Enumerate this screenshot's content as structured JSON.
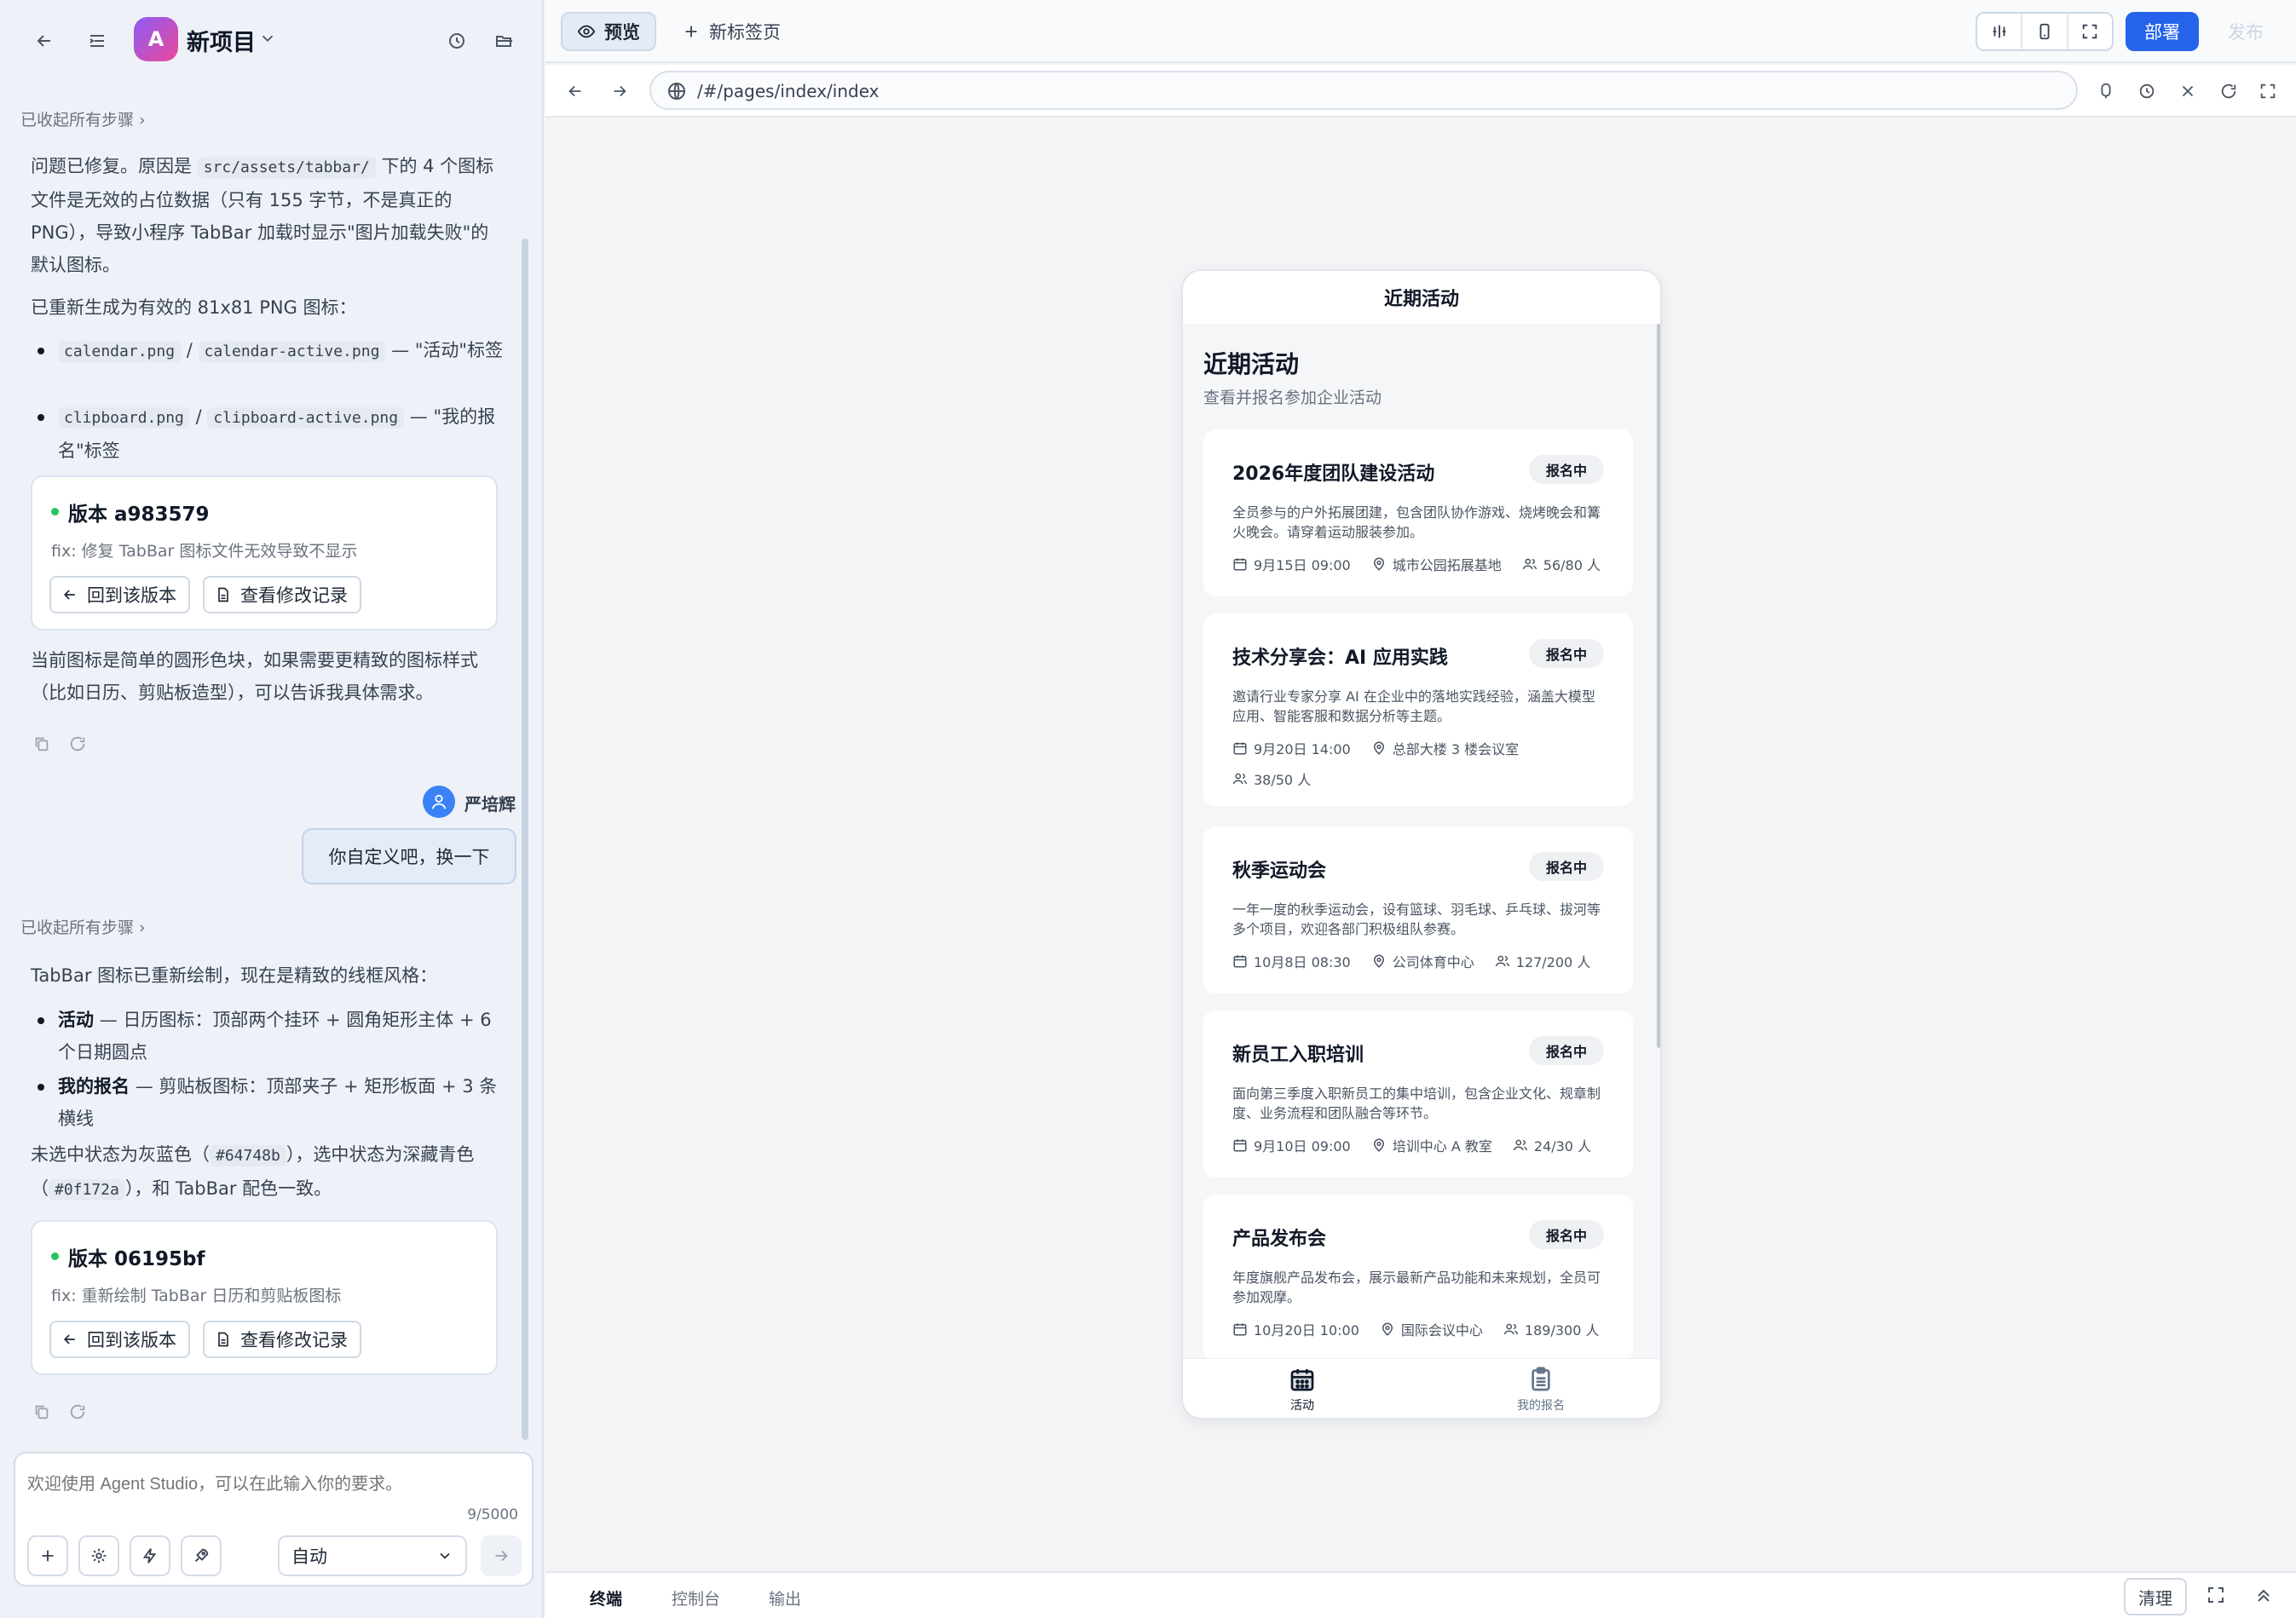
{
  "project": {
    "avatar_letter": "A",
    "name": "新项目"
  },
  "chat": {
    "collapsed_label": "已收起所有步骤",
    "msg1": {
      "p1_a": "问题已修复。原因是",
      "p1_code": "src/assets/tabbar/",
      "p1_b": "下的 4 个图标文件是无效的占位数据（只有 155 字节，不是真正的 PNG），导致小程序 TabBar 加载时显示\"图片加载失败\"的默认图标。",
      "p2": "已重新生成为有效的 81x81 PNG 图标：",
      "li1_code1": "calendar.png",
      "li1_sep": "/",
      "li1_code2": "calendar-active.png",
      "li1_text": "— \"活动\"标签",
      "li2_code1": "clipboard.png",
      "li2_sep": "/",
      "li2_code2": "clipboard-active.png",
      "li2_text": "— \"我的报名\"标签",
      "version": {
        "title": "版本 a983579",
        "message": "fix: 修复 TabBar 图标文件无效导致不显示"
      },
      "p3": "当前图标是简单的圆形色块，如果需要更精致的图标样式（比如日历、剪贴板造型），可以告诉我具体需求。"
    },
    "user": {
      "name": "严培辉",
      "message": "你自定义吧，换一下"
    },
    "msg2": {
      "p1": "TabBar 图标已重新绘制，现在是精致的线框风格：",
      "li1_bold": "活动",
      "li1_text": "— 日历图标：顶部两个挂环 + 圆角矩形主体 + 6 个日期圆点",
      "li2_bold": "我的报名",
      "li2_text": "— 剪贴板图标：顶部夹子 + 矩形板面 + 3 条横线",
      "p2_a": "未选中状态为灰蓝色（",
      "p2_code1": "#64748b",
      "p2_b": "），选中状态为深藏青色（",
      "p2_code2": "#0f172a",
      "p2_c": "），和 TabBar 配色一致。",
      "version": {
        "title": "版本 06195bf",
        "message": "fix: 重新绘制 TabBar 日历和剪贴板图标"
      }
    },
    "btn_revert": "回到该版本",
    "btn_changes": "查看修改记录"
  },
  "composer": {
    "placeholder": "欢迎使用 Agent Studio，可以在此输入你的要求。",
    "count": "9/5000",
    "mode": "自动"
  },
  "tabs": {
    "preview": "预览",
    "new_tab": "新标签页"
  },
  "actions": {
    "deploy": "部署",
    "publish": "发布"
  },
  "url": "/#/pages/index/index",
  "phone": {
    "nav_title": "近期活动",
    "page_title": "近期活动",
    "page_subtitle": "查看并报名参加企业活动",
    "badge": "报名中",
    "events": [
      {
        "title": "2026年度团队建设活动",
        "desc": "全员参与的户外拓展团建，包含团队协作游戏、烧烤晚会和篝火晚会。请穿着运动服装参加。",
        "time": "9月15日 09:00",
        "place": "城市公园拓展基地",
        "people": "56/80 人"
      },
      {
        "title": "技术分享会：AI 应用实践",
        "desc": "邀请行业专家分享 AI 在企业中的落地实践经验，涵盖大模型应用、智能客服和数据分析等主题。",
        "time": "9月20日 14:00",
        "place": "总部大楼 3 楼会议室",
        "people": "38/50 人"
      },
      {
        "title": "秋季运动会",
        "desc": "一年一度的秋季运动会，设有篮球、羽毛球、乒乓球、拔河等多个项目，欢迎各部门积极组队参赛。",
        "time": "10月8日 08:30",
        "place": "公司体育中心",
        "people": "127/200 人"
      },
      {
        "title": "新员工入职培训",
        "desc": "面向第三季度入职新员工的集中培训，包含企业文化、规章制度、业务流程和团队融合等环节。",
        "time": "9月10日 09:00",
        "place": "培训中心 A 教室",
        "people": "24/30 人"
      },
      {
        "title": "产品发布会",
        "desc": "年度旗舰产品发布会，展示最新产品功能和未来规划，全员可参加观摩。",
        "time": "10月20日 10:00",
        "place": "国际会议中心",
        "people": "189/300 人"
      }
    ],
    "tab_activity": "活动",
    "tab_mine": "我的报名"
  },
  "bottom": {
    "terminal": "终端",
    "console": "控制台",
    "output": "输出",
    "clear": "清理"
  },
  "colors": {
    "accent": "#2563eb",
    "online": "#22c55e"
  }
}
